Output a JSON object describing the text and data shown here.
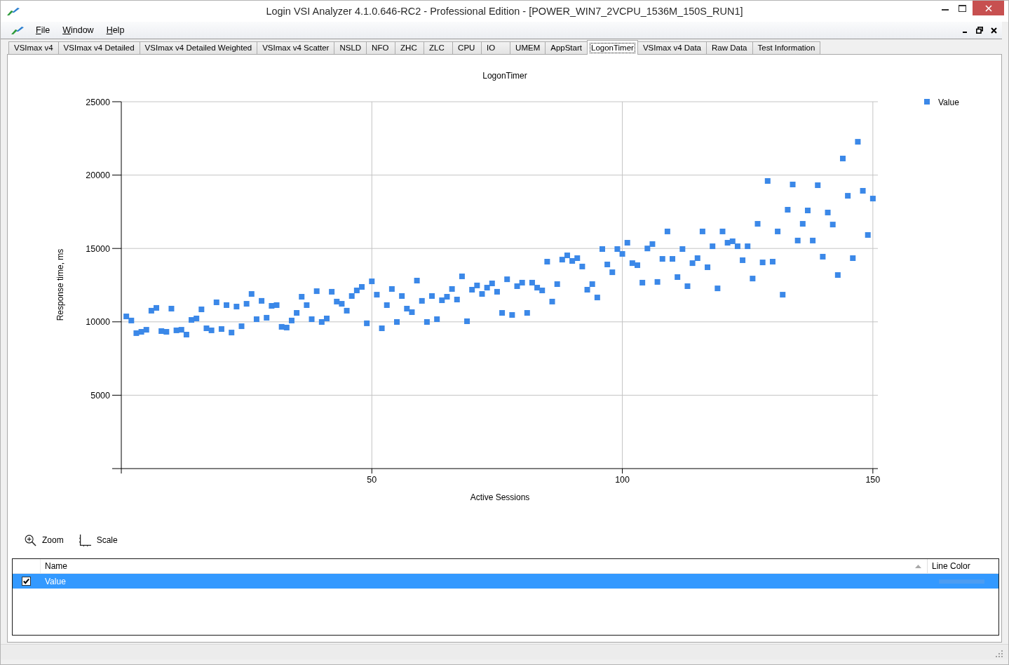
{
  "window": {
    "title": "Login VSI Analyzer 4.1.0.646-RC2 - Professional Edition - [POWER_WIN7_2VCPU_1536M_150S_RUN1]"
  },
  "menu": [
    "File",
    "Window",
    "Help"
  ],
  "tabs": [
    {
      "label": "VSImax v4",
      "selected": false
    },
    {
      "label": "VSImax v4 Detailed",
      "selected": false
    },
    {
      "label": "VSImax v4 Detailed Weighted",
      "selected": false
    },
    {
      "label": "VSImax v4 Scatter",
      "selected": false
    },
    {
      "label": "NSLD",
      "selected": false
    },
    {
      "label": "NFO",
      "selected": false
    },
    {
      "label": "ZHC",
      "selected": false
    },
    {
      "label": "ZLC",
      "selected": false
    },
    {
      "label": "CPU",
      "selected": false
    },
    {
      "label": "IO",
      "selected": false
    },
    {
      "label": "UMEM",
      "selected": false
    },
    {
      "label": "AppStart",
      "selected": false
    },
    {
      "label": "LogonTimer",
      "selected": true
    },
    {
      "label": "VSImax v4 Data",
      "selected": false
    },
    {
      "label": "Raw Data",
      "selected": false
    },
    {
      "label": "Test Information",
      "selected": false
    }
  ],
  "chart": {
    "chart_data": {
      "type": "scatter",
      "title": "LogonTimer",
      "xlabel": "Active Sessions",
      "ylabel": "Response time, ms",
      "grid": true,
      "xlim": [
        0,
        151
      ],
      "ylim": [
        0,
        25000
      ],
      "xticks": [
        50,
        100,
        150
      ],
      "yticks": [
        5000,
        10000,
        15000,
        20000,
        25000
      ],
      "x": [
        1,
        2,
        3,
        4,
        5,
        6,
        7,
        8,
        9,
        10,
        11,
        12,
        13,
        14,
        15,
        16,
        17,
        18,
        19,
        20,
        21,
        22,
        23,
        24,
        25,
        26,
        27,
        28,
        29,
        30,
        31,
        32,
        33,
        34,
        35,
        36,
        37,
        38,
        39,
        40,
        41,
        42,
        43,
        44,
        45,
        46,
        47,
        48,
        49,
        50,
        51,
        52,
        53,
        54,
        55,
        56,
        57,
        58,
        59,
        60,
        61,
        62,
        63,
        64,
        65,
        66,
        67,
        68,
        69,
        70,
        71,
        72,
        73,
        74,
        75,
        76,
        77,
        78,
        79,
        80,
        81,
        82,
        83,
        84,
        85,
        86,
        87,
        88,
        89,
        90,
        91,
        92,
        93,
        94,
        95,
        96,
        97,
        98,
        99,
        100,
        101,
        102,
        103,
        104,
        105,
        106,
        107,
        108,
        109,
        110,
        111,
        112,
        113,
        114,
        115,
        116,
        117,
        118,
        119,
        120,
        121,
        122,
        123,
        124,
        125,
        126,
        127,
        128,
        129,
        130,
        131,
        132,
        133,
        134,
        135,
        136,
        137,
        138,
        139,
        140,
        141,
        142,
        143,
        144,
        145,
        146,
        147,
        148,
        149,
        150
      ],
      "series": [
        {
          "name": "Value",
          "color": "#3b88e8",
          "values": [
            10370,
            10090,
            9230,
            9320,
            9460,
            10760,
            10950,
            9370,
            9320,
            10900,
            9420,
            9460,
            9130,
            10130,
            10230,
            10850,
            9560,
            9420,
            11330,
            9510,
            11140,
            9270,
            11040,
            9700,
            11230,
            11900,
            10180,
            11430,
            10280,
            11090,
            11140,
            9660,
            9610,
            10090,
            10610,
            11710,
            11140,
            10180,
            12090,
            9990,
            10230,
            12050,
            11380,
            11230,
            10760,
            11760,
            12140,
            12380,
            9900,
            12760,
            11850,
            9560,
            11140,
            12240,
            9990,
            11760,
            10900,
            10660,
            12810,
            11430,
            9990,
            11760,
            10180,
            11470,
            11710,
            12240,
            11520,
            13100,
            10040,
            12190,
            12480,
            11900,
            12330,
            12620,
            12050,
            10610,
            12900,
            10470,
            12430,
            12670,
            10610,
            12670,
            12330,
            12140,
            14100,
            11380,
            12570,
            14240,
            14530,
            14150,
            14340,
            13770,
            12190,
            12570,
            11660,
            14960,
            13910,
            13380,
            14960,
            14630,
            15390,
            14000,
            13860,
            12670,
            15000,
            15300,
            12720,
            14290,
            16160,
            14290,
            13050,
            14960,
            12430,
            14000,
            14340,
            16160,
            13720,
            15150,
            12280,
            16160,
            15390,
            15490,
            15150,
            14200,
            15150,
            12950,
            16680,
            14050,
            19600,
            14100,
            16160,
            11850,
            17640,
            19360,
            15540,
            16680,
            17590,
            15540,
            19310,
            14440,
            17450,
            16630,
            13190,
            21130,
            18590,
            14340,
            22270,
            18930,
            15920,
            18400
          ]
        }
      ]
    }
  },
  "chart_toolbar": [
    {
      "kind": "zoom",
      "label": "Zoom"
    },
    {
      "kind": "scale",
      "label": "Scale"
    }
  ],
  "series_grid": {
    "columns": [
      {
        "label": "Name",
        "sorted": true
      },
      {
        "label": "Line Color",
        "sorted": false
      }
    ],
    "rows": [
      {
        "name": "Value",
        "checked": true,
        "selected": true,
        "color": "#4d9df2"
      }
    ]
  }
}
